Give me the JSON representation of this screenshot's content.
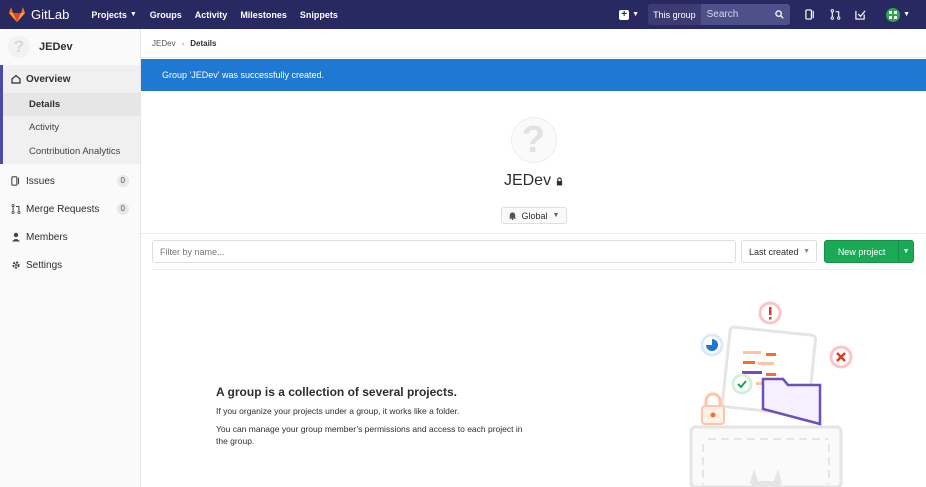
{
  "topnav": {
    "brand": "GitLab",
    "links": [
      {
        "label": "Projects",
        "has_dropdown": true
      },
      {
        "label": "Groups",
        "has_dropdown": false
      },
      {
        "label": "Activity",
        "has_dropdown": false
      },
      {
        "label": "Milestones",
        "has_dropdown": false
      },
      {
        "label": "Snippets",
        "has_dropdown": false
      }
    ],
    "search_scope": "This group",
    "search_placeholder": "Search",
    "icons": [
      "plus-icon",
      "issues-icon",
      "merge-request-icon",
      "todo-icon",
      "user-avatar"
    ]
  },
  "sidebar": {
    "group_name": "JEDev",
    "items": [
      {
        "label": "Overview",
        "icon": "home-icon",
        "active": true
      },
      {
        "label": "Details"
      },
      {
        "label": "Activity"
      },
      {
        "label": "Contribution Analytics"
      },
      {
        "label": "Issues",
        "icon": "issues-icon",
        "count": "0"
      },
      {
        "label": "Merge Requests",
        "icon": "merge-request-icon",
        "count": "0"
      },
      {
        "label": "Members",
        "icon": "members-icon"
      },
      {
        "label": "Settings",
        "icon": "settings-icon"
      }
    ]
  },
  "breadcrumb": {
    "parent": "JEDev",
    "current": "Details"
  },
  "flash": "Group 'JEDev' was successfully created.",
  "group": {
    "title": "JEDev",
    "notification": "Global"
  },
  "filter": {
    "placeholder": "Filter by name...",
    "sort": "Last created",
    "new_project": "New project"
  },
  "empty_state": {
    "title": "A group is a collection of several projects.",
    "p1": "If you organize your projects under a group, it works like a folder.",
    "p2": "You can manage your group member’s permissions and access to each project in the group."
  },
  "colors": {
    "nav_bg": "#292961",
    "flash_bg": "#1f78d1",
    "primary_green": "#1aaa55",
    "sidebar_accent": "#4b4ba3"
  }
}
